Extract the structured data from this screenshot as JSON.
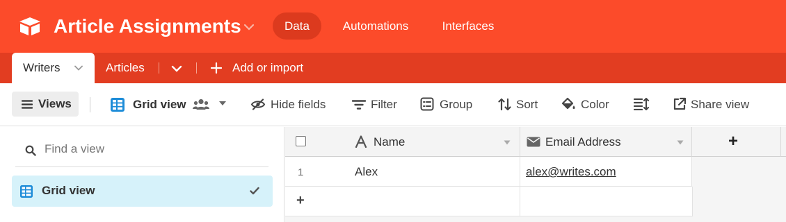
{
  "header": {
    "base_title": "Article Assignments",
    "nav": [
      {
        "label": "Data",
        "active": true
      },
      {
        "label": "Automations",
        "active": false
      },
      {
        "label": "Interfaces",
        "active": false
      }
    ],
    "brand_color": "#fc4b2a"
  },
  "tables": {
    "tabs": [
      {
        "label": "Writers",
        "active": true
      },
      {
        "label": "Articles",
        "active": false
      }
    ],
    "add_label": "Add or import"
  },
  "toolbar": {
    "views_label": "Views",
    "view_name": "Grid view",
    "hide_fields": "Hide fields",
    "filter": "Filter",
    "group": "Group",
    "sort": "Sort",
    "color": "Color",
    "share_view": "Share view"
  },
  "sidebar": {
    "search_placeholder": "Find a view",
    "views": [
      {
        "label": "Grid view",
        "selected": true
      }
    ]
  },
  "grid": {
    "columns": [
      {
        "label": "Name",
        "icon": "text-type-icon"
      },
      {
        "label": "Email Address",
        "icon": "email-envelope-icon"
      }
    ],
    "rows": [
      {
        "num": "1",
        "name": "Alex",
        "email": "alex@writes.com"
      }
    ],
    "add_field_symbol": "+",
    "add_row_symbol": "+"
  }
}
